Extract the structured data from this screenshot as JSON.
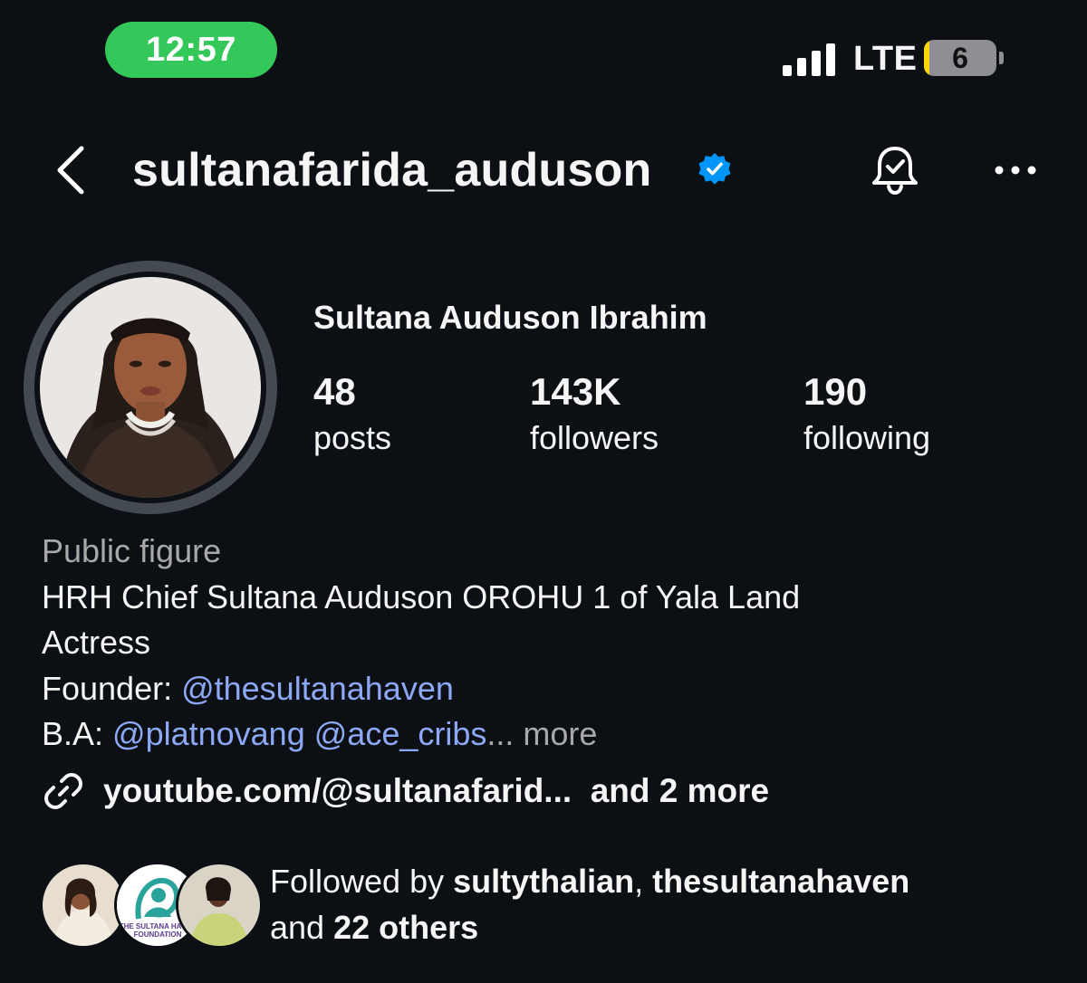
{
  "status_bar": {
    "time": "12:57",
    "network": "LTE",
    "battery_level": "6",
    "battery_fraction": 0.06,
    "colors": {
      "time_pill": "#34c759",
      "battery_fill": "#ffd60a"
    }
  },
  "header": {
    "username": "sultanafarida_auduson",
    "verified": true,
    "icons": [
      "back-chevron-icon",
      "verified-badge-icon",
      "bell-check-icon",
      "more-ellipsis-icon"
    ]
  },
  "profile": {
    "full_name": "Sultana Auduson Ibrahim",
    "stats": [
      {
        "value": "48",
        "label": "posts"
      },
      {
        "value": "143K",
        "label": "followers"
      },
      {
        "value": "190",
        "label": "following"
      }
    ]
  },
  "bio": {
    "category": "Public figure",
    "line1": "HRH Chief Sultana Auduson OROHU 1 of Yala Land",
    "line2": "Actress",
    "founder_prefix": "Founder: ",
    "founder_mention": "@thesultanahaven",
    "ba_prefix": "B.A: ",
    "ba_mention1": "@platnovang",
    "ba_mention2": "@ace_cribs",
    "ellipsis": "...",
    "more": " more"
  },
  "links": {
    "text": "youtube.com/@sultanafarid...  and 2 more"
  },
  "followed_by": {
    "prefix": "Followed by ",
    "user1": "sultythalian",
    "separator": ", ",
    "user2": "thesultanahaven",
    "and": "and ",
    "others": "22 others",
    "foundation_logo_text": "THE SULTANA HAVEN FOUNDATION"
  },
  "colors": {
    "background": "#0c1014",
    "text": "#f5f5f5",
    "muted": "#a8a8a8",
    "mention": "#8da8f5",
    "verified": "#0095f6"
  }
}
